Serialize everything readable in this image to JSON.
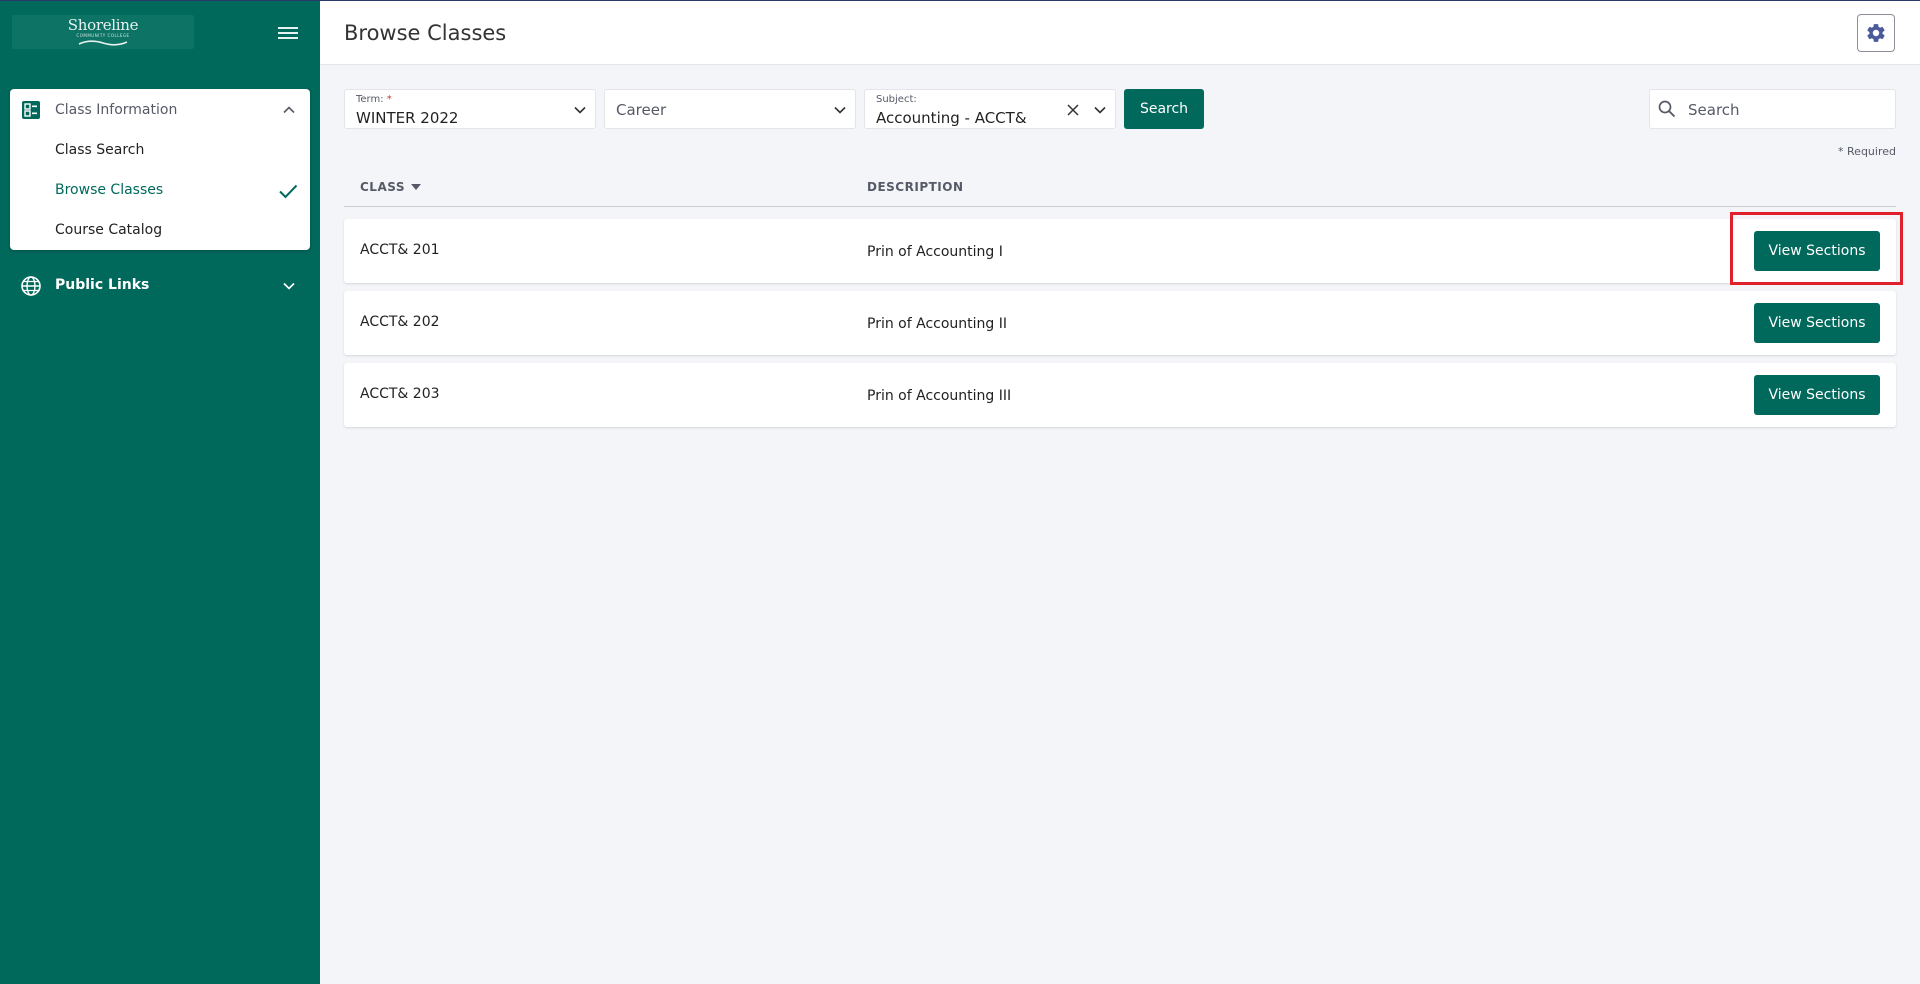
{
  "sidebar": {
    "logo": {
      "name": "Shoreline",
      "sub": "COMMUNITY COLLEGE"
    },
    "section": {
      "label": "Class Information",
      "items": [
        {
          "label": "Class Search"
        },
        {
          "label": "Browse Classes"
        },
        {
          "label": "Course Catalog"
        }
      ]
    },
    "public_links": {
      "label": "Public Links"
    }
  },
  "header": {
    "title": "Browse Classes"
  },
  "filters": {
    "term": {
      "label": "Term:",
      "required_mark": "*",
      "value": "WINTER 2022"
    },
    "career": {
      "placeholder": "Career"
    },
    "subject": {
      "label": "Subject:",
      "value": "Accounting - ACCT&"
    },
    "search_button": "Search",
    "search_input": {
      "placeholder": "Search",
      "value": ""
    },
    "required_note": "* Required"
  },
  "table": {
    "columns": {
      "class": "CLASS",
      "description": "DESCRIPTION"
    },
    "rows": [
      {
        "class": "ACCT& 201",
        "description": "Prin of Accounting I",
        "action": "View Sections"
      },
      {
        "class": "ACCT& 202",
        "description": "Prin of Accounting II",
        "action": "View Sections"
      },
      {
        "class": "ACCT& 203",
        "description": "Prin of Accounting III",
        "action": "View Sections"
      }
    ]
  },
  "colors": {
    "brand": "#00695c",
    "background": "#f4f5f9",
    "highlight": "#e0202a"
  }
}
